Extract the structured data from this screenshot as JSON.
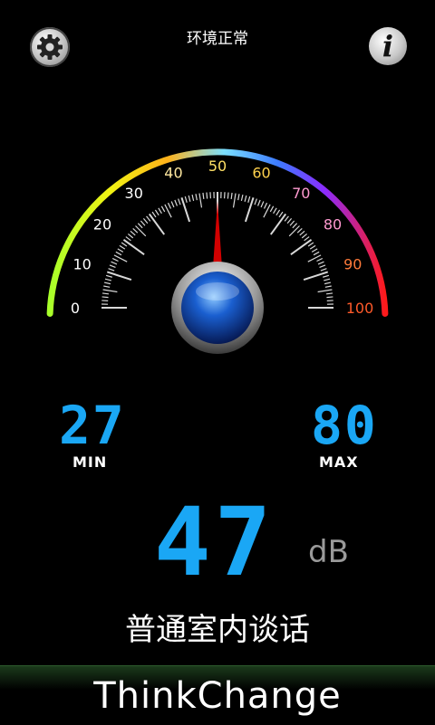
{
  "header": {
    "status_text": "环境正常",
    "settings_icon": "gear-icon",
    "info_label": "i"
  },
  "gauge": {
    "ticks": [
      "0",
      "10",
      "20",
      "30",
      "40",
      "50",
      "60",
      "70",
      "80",
      "90",
      "100"
    ],
    "needle_value": 50,
    "min_value": 0,
    "max_value": 100
  },
  "stats": {
    "min_value": "27",
    "min_label": "MIN",
    "max_value": "80",
    "max_label": "MAX"
  },
  "reading": {
    "value": "47",
    "unit": "dB",
    "description": "普通室内谈话"
  },
  "footer": {
    "brand": "ThinkChange"
  },
  "colors": {
    "digit": "#1aa7f5",
    "needle": "#d20000",
    "knob": "#1a5fd0"
  }
}
